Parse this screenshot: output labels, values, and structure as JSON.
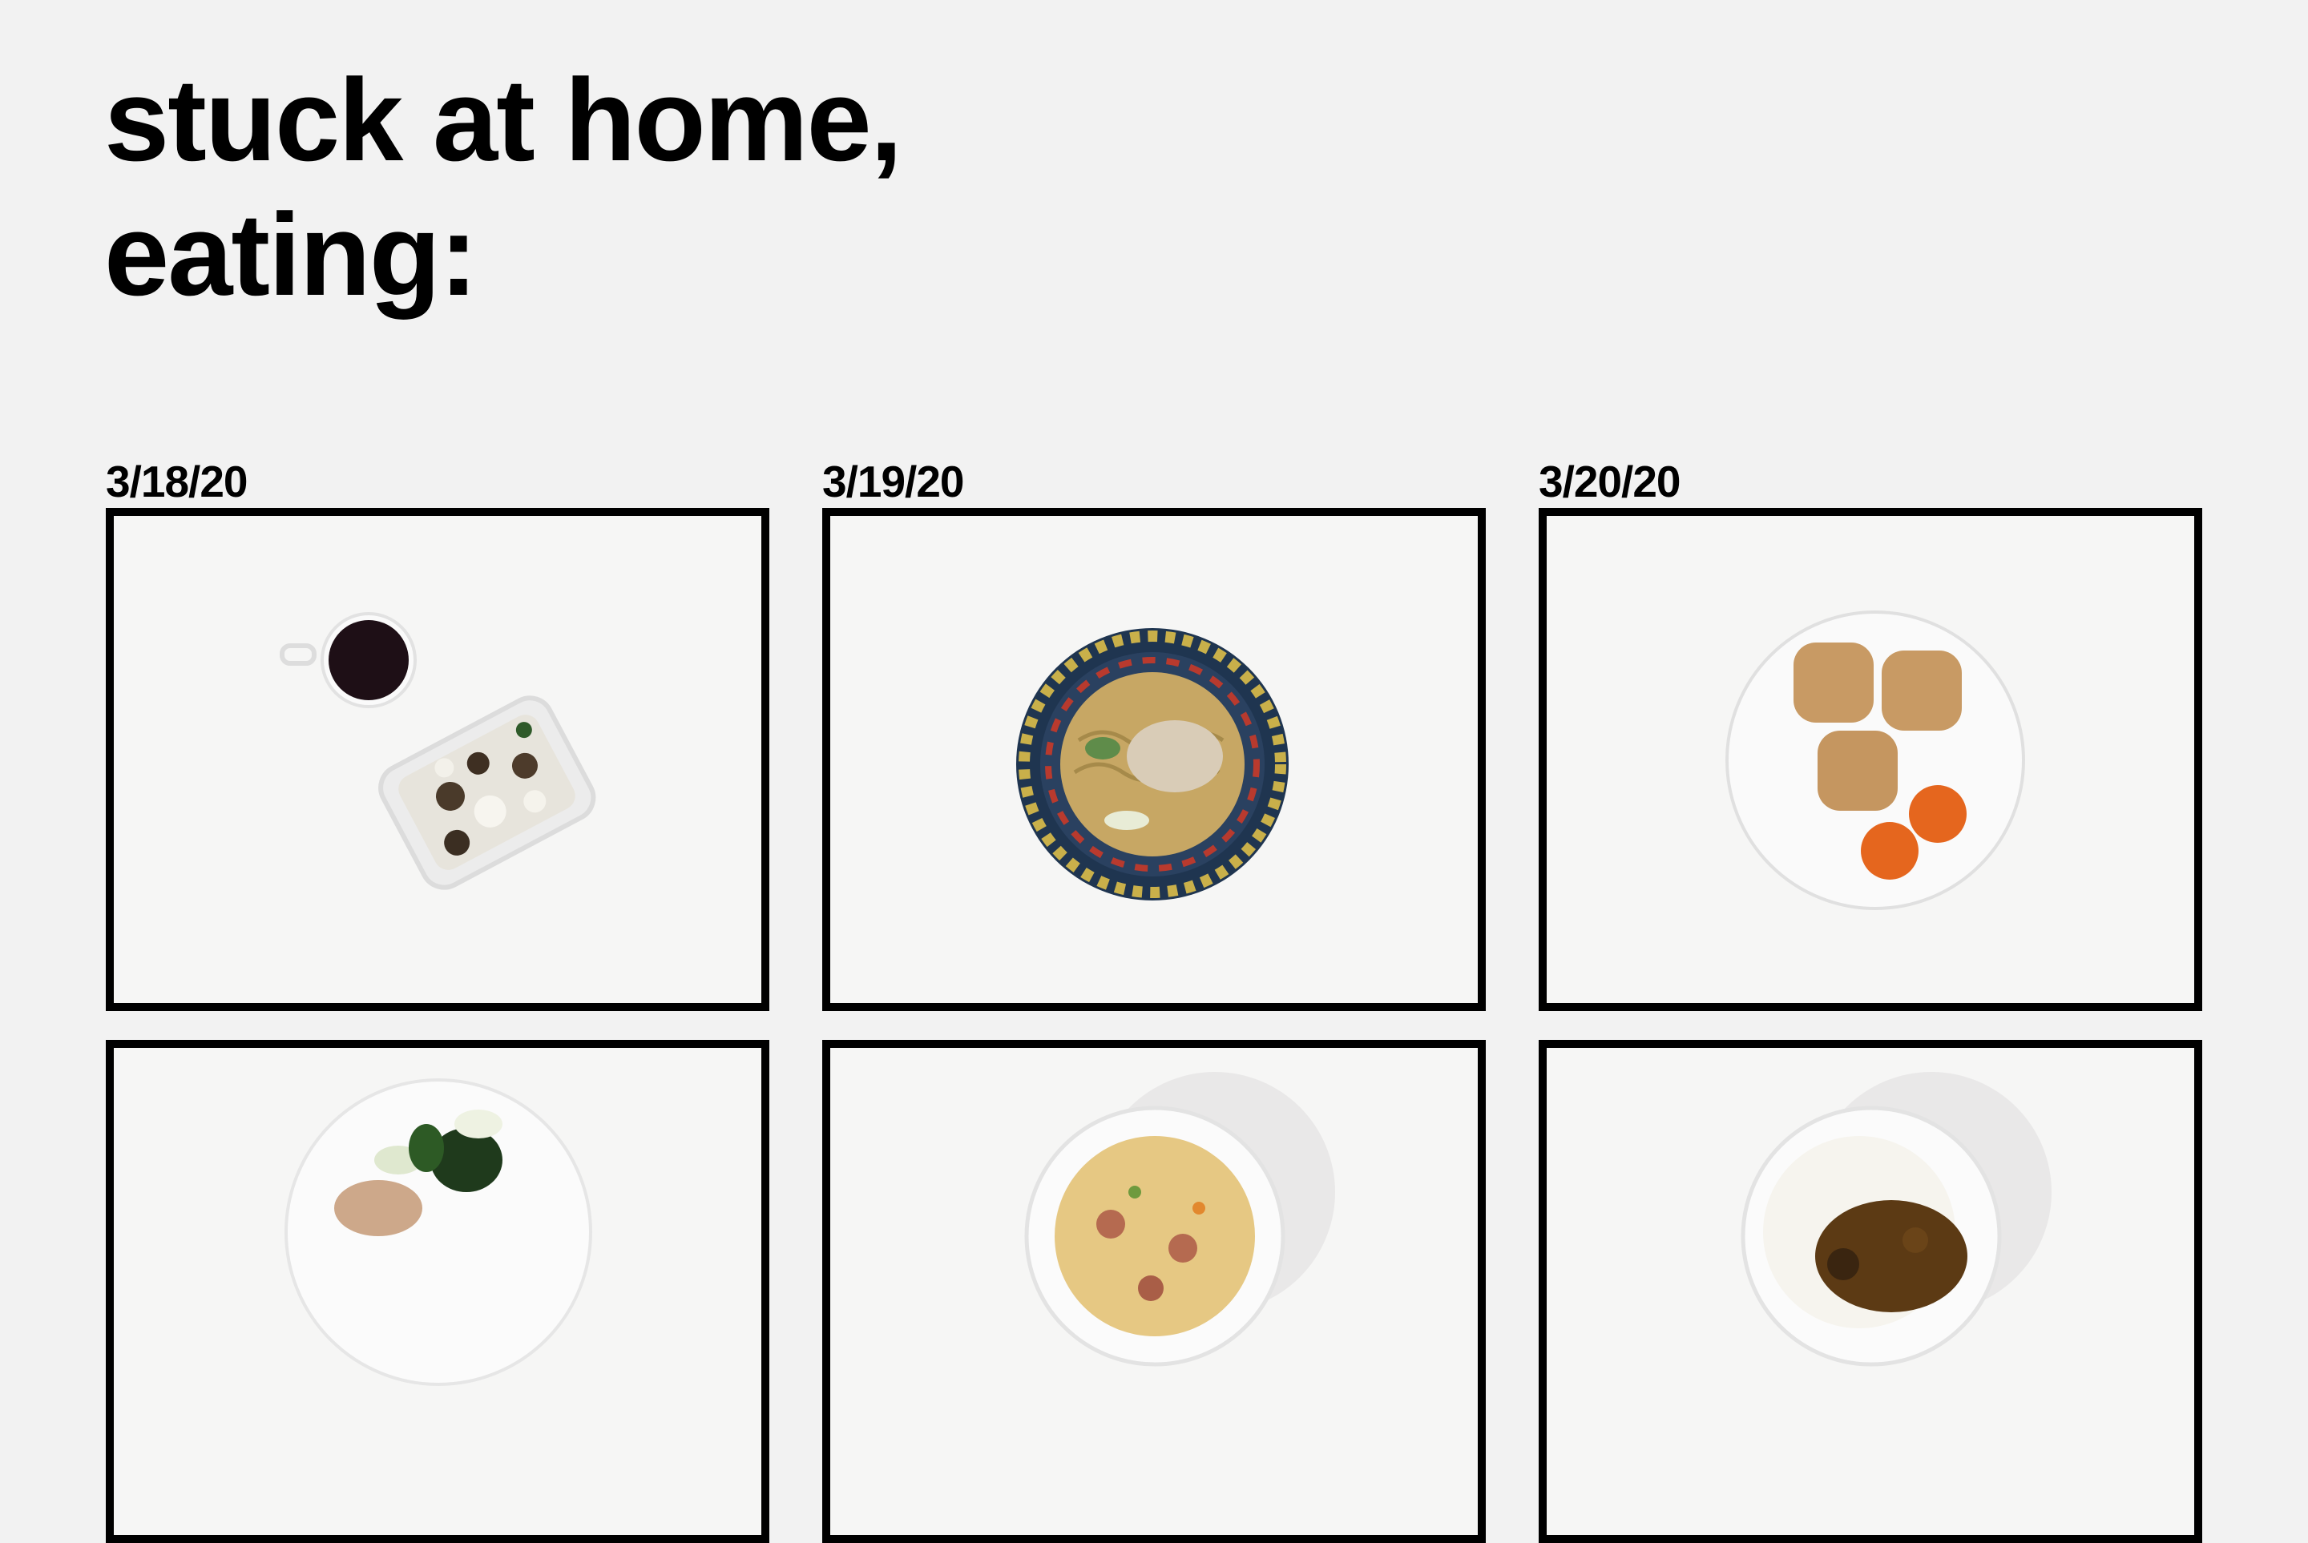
{
  "page": {
    "title_lines": [
      "stuck at home,",
      "eating:"
    ]
  },
  "entries": [
    {
      "date": "3/18/20",
      "photo_icon": "coffee-and-rice-photo-icon"
    },
    {
      "date": "3/19/20",
      "photo_icon": "noodles-plate-photo-icon"
    },
    {
      "date": "3/20/20",
      "photo_icon": "buns-and-oranges-photo-icon"
    },
    {
      "photo_icon": "greens-plate-photo-icon"
    },
    {
      "photo_icon": "pasta-bowl-photo-icon"
    },
    {
      "photo_icon": "curry-rice-bowl-photo-icon"
    }
  ]
}
